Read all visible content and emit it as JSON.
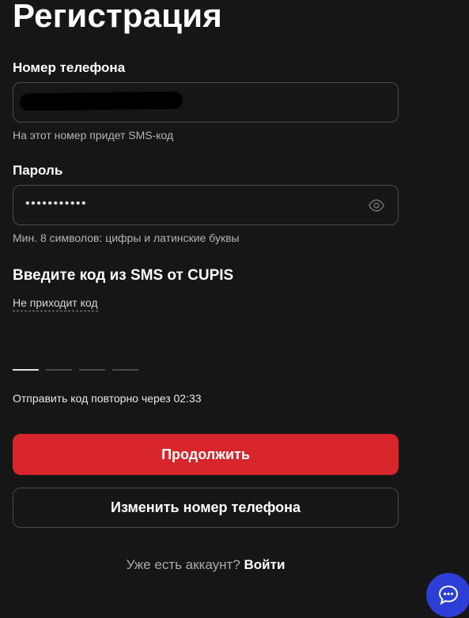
{
  "page": {
    "title": "Регистрация"
  },
  "phone": {
    "label": "Номер телефона",
    "hint": "На этот номер придет SMS-код"
  },
  "password": {
    "label": "Пароль",
    "masked_value": "•••••••••••",
    "hint": "Мин. 8 символов: цифры и латинские буквы",
    "toggle_icon": "eye-icon"
  },
  "sms": {
    "title": "Введите код из SMS от CUPIS",
    "no_code_link": "Не приходит код",
    "resend_text": "Отправить код повторно через 02:33"
  },
  "buttons": {
    "continue": "Продолжить",
    "change_phone": "Изменить номер телефона"
  },
  "login": {
    "question": "Уже есть аккаунт?",
    "link": "Войти"
  },
  "chat": {
    "icon": "chat-bubble-icon"
  },
  "colors": {
    "background": "#161616",
    "primary": "#d6252b",
    "border": "#4a4a4a",
    "chat": "#2b3fd6"
  }
}
